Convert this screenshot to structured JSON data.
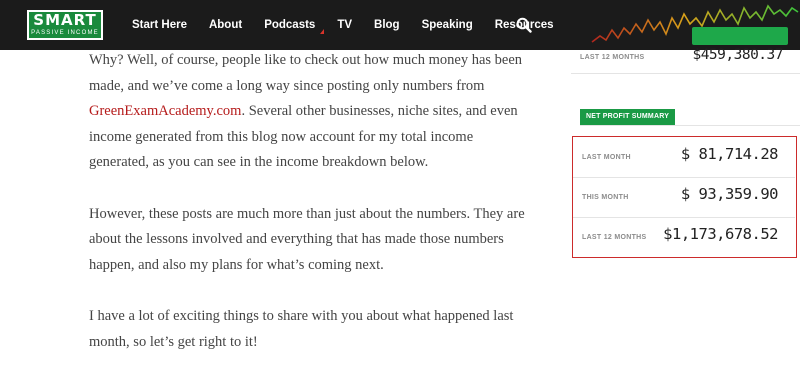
{
  "logo": {
    "line1": "SMART",
    "line2": "PASSIVE INCOME"
  },
  "nav": {
    "items": [
      {
        "label": "Start Here"
      },
      {
        "label": "About"
      },
      {
        "label": "Podcasts"
      },
      {
        "label": "TV"
      },
      {
        "label": "Blog"
      },
      {
        "label": "Speaking"
      },
      {
        "label": "Resources"
      }
    ]
  },
  "article": {
    "p1_before": "Why? Well, of course, people like to check out how much money has been made, and we’ve come a long way since posting only numbers from ",
    "p1_link": "GreenExamAcademy.com",
    "p1_after": ". Several other businesses, niche sites, and even income generated from this blog now account for my total income generated, as you can see in the income breakdown below.",
    "p2": "However, these posts are much more than just about the numbers. They are about the lessons involved and everything that has made those numbers happen, and also my plans for what’s coming next.",
    "p3": "I have a lot of exciting things to share with you about what happened last month, so let’s get right to it!"
  },
  "sidebar": {
    "prev_row": {
      "label": "LAST 12 MONTHS",
      "value": "$459,380.37"
    },
    "section_title": "NET PROFIT SUMMARY",
    "summary": [
      {
        "label": "LAST MONTH",
        "value": "$ 81,714.28"
      },
      {
        "label": "THIS MONTH",
        "value": "$ 93,359.90"
      },
      {
        "label": "LAST 12 MONTHS",
        "value": "$1,173,678.52"
      }
    ]
  },
  "colors": {
    "nav_bg": "#1b1b1b",
    "brand_green": "#1a9a45",
    "link_red": "#b51a1a",
    "highlight_border": "#cc2b2b"
  },
  "icons": {
    "search": "search-icon",
    "caret": "dropdown-caret-icon"
  }
}
